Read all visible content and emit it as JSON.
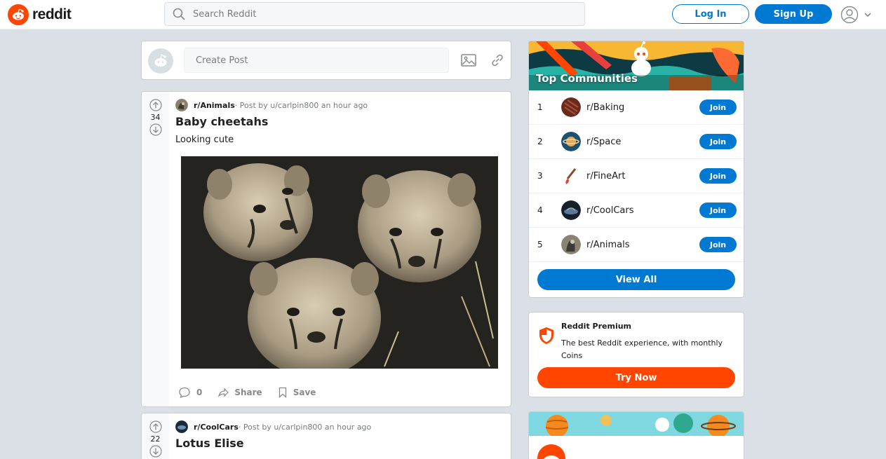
{
  "header": {
    "logo_text": "reddit",
    "search_placeholder": "Search Reddit",
    "login_label": "Log In",
    "signup_label": "Sign Up"
  },
  "create_post": {
    "placeholder": "Create Post"
  },
  "posts": [
    {
      "subreddit": "r/Animals",
      "meta": " · Post by u/carlpin800 an hour ago",
      "votes": "34",
      "title": "Baby cheetahs",
      "text": "Looking cute",
      "comments": "0",
      "share_label": "Share",
      "save_label": "Save"
    },
    {
      "subreddit": "r/CoolCars",
      "meta": " · Post by u/carlpin800 an hour ago",
      "votes": "22",
      "title": "Lotus Elise"
    }
  ],
  "top_communities": {
    "title": "Top Communities",
    "items": [
      {
        "rank": "1",
        "name": "r/Baking",
        "join": "Join"
      },
      {
        "rank": "2",
        "name": "r/Space",
        "join": "Join"
      },
      {
        "rank": "3",
        "name": "r/FineArt",
        "join": "Join"
      },
      {
        "rank": "4",
        "name": "r/CoolCars",
        "join": "Join"
      },
      {
        "rank": "5",
        "name": "r/Animals",
        "join": "Join"
      }
    ],
    "view_all": "View All"
  },
  "premium": {
    "title": "Reddit Premium",
    "description": "The best Reddit experience, with monthly Coins",
    "button": "Try Now"
  },
  "colors": {
    "brand": "#ff4500",
    "accent": "#0079d3",
    "background": "#dae0e6"
  },
  "icons": [
    "reddit-logo-icon",
    "search-icon",
    "user-icon",
    "chevron-down-icon",
    "image-icon",
    "link-icon",
    "upvote-icon",
    "downvote-icon",
    "comment-icon",
    "share-icon",
    "save-icon",
    "shield-icon"
  ]
}
